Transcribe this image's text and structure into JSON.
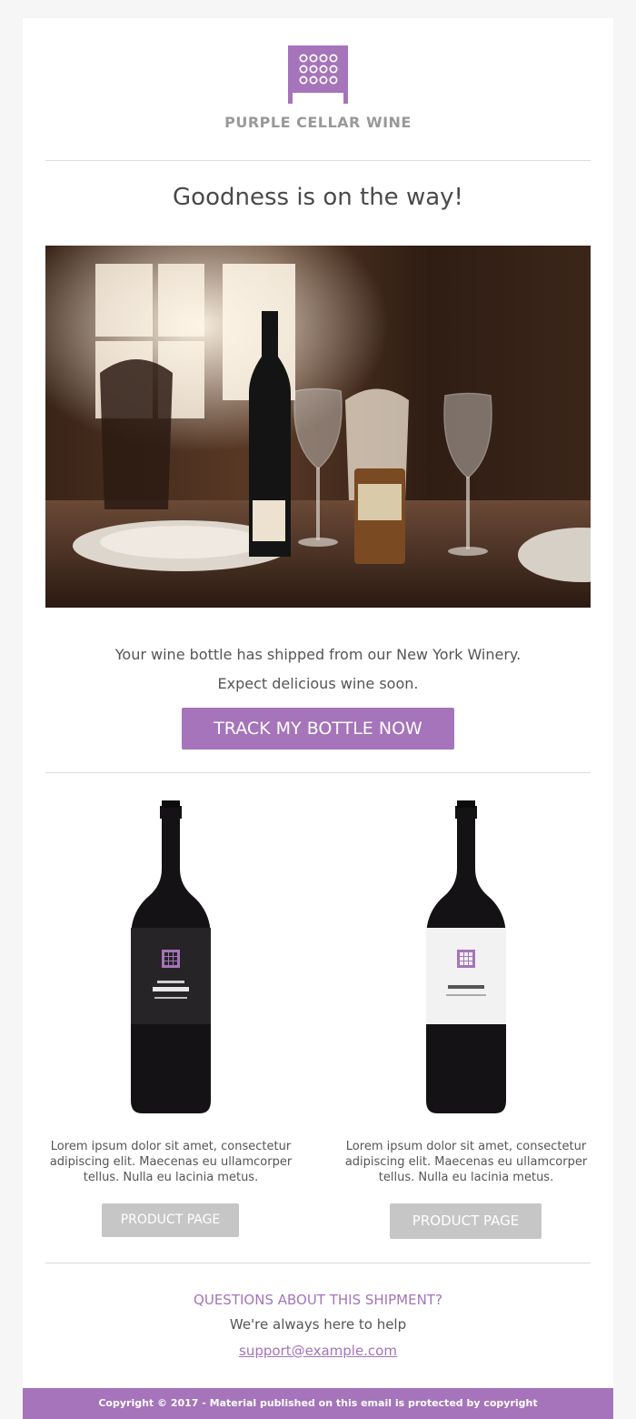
{
  "brand": {
    "name": "PURPLE CELLAR WINE",
    "logo_icon": "wine-rack-icon",
    "accent_color": "#a574ba"
  },
  "headline": "Goodness is on the way!",
  "hero": {
    "icon": "restaurant-table-wine-photo"
  },
  "shipment": {
    "line1": "Your wine bottle has shipped from our New York Winery.",
    "line2": "Expect delicious wine soon.",
    "cta_label": "TRACK MY BOTTLE NOW"
  },
  "products": [
    {
      "label_style": "black",
      "description": "Lorem ipsum dolor sit amet, consectetur adipiscing elit. Maecenas eu ullamcorper tellus. Nulla eu lacinia metus.",
      "button_label": "PRODUCT PAGE"
    },
    {
      "label_style": "white",
      "description": "Lorem ipsum dolor sit amet, consectetur adipiscing elit. Maecenas eu ullamcorper tellus. Nulla eu lacinia metus.",
      "button_label": "PRODUCT PAGE"
    }
  ],
  "support": {
    "title": "QUESTIONS ABOUT THIS SHIPMENT?",
    "subtitle": "We're always here to help",
    "email": "support@example.com"
  },
  "footer": {
    "copyright": "Copyright © 2017 - Material published on this email is protected by copyright"
  }
}
